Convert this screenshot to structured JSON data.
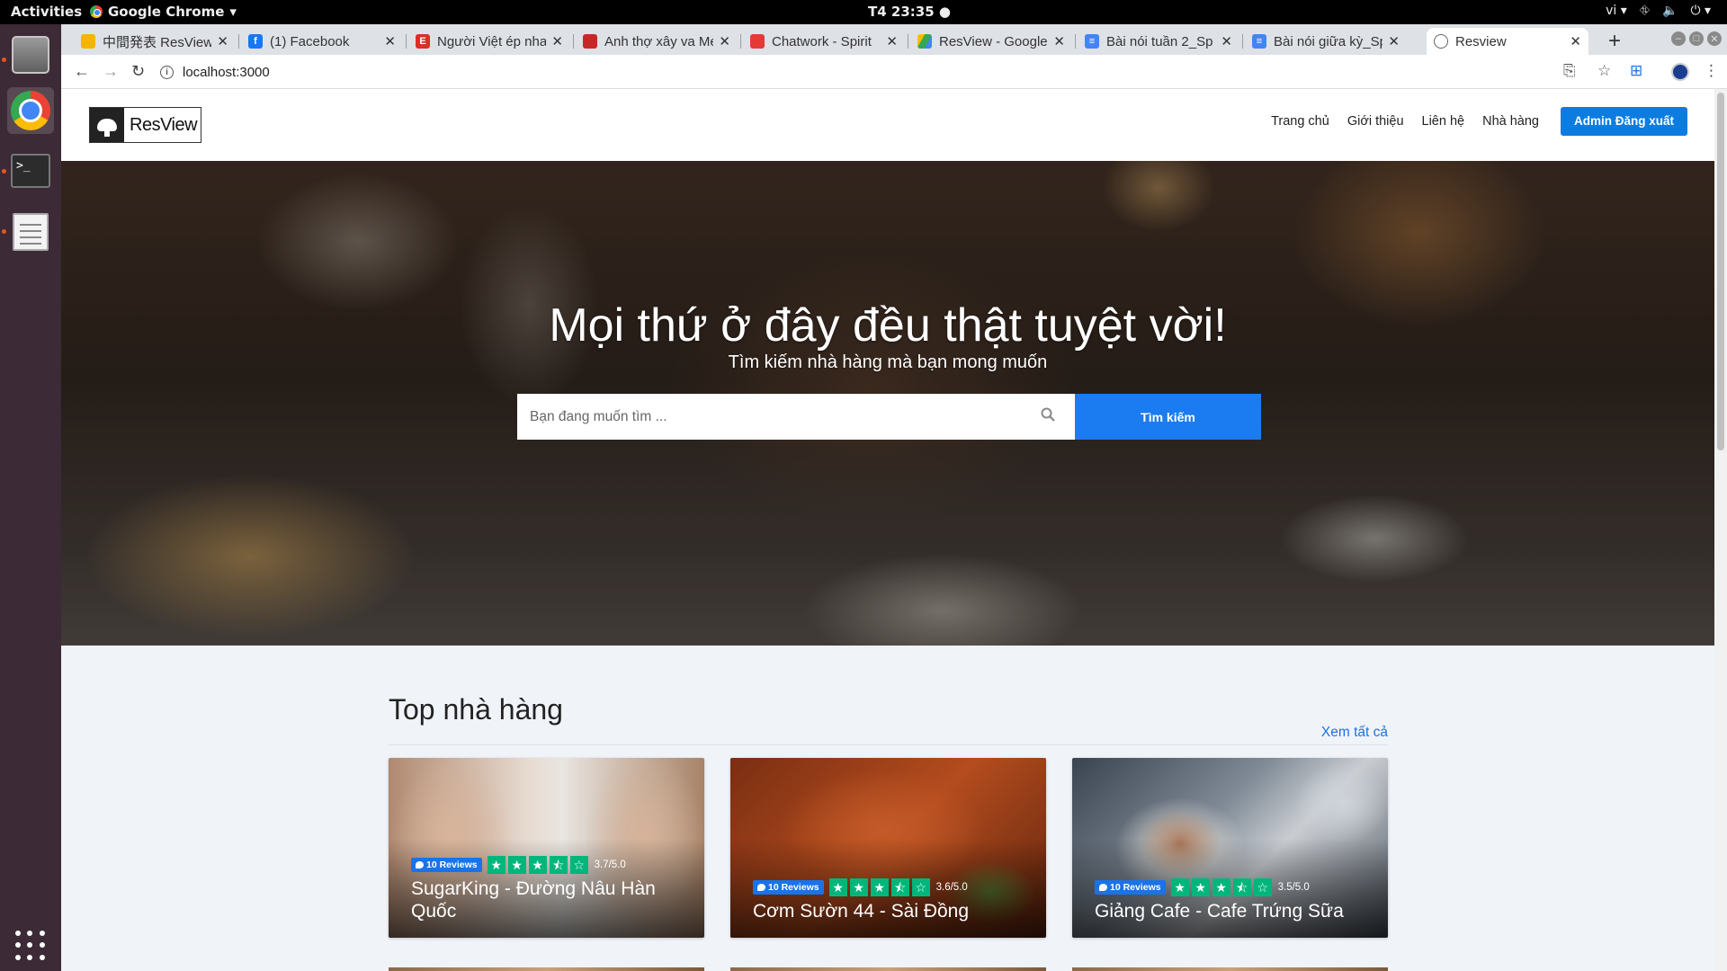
{
  "system": {
    "activities": "Activities",
    "app_menu": "Google Chrome",
    "clock": "T4 23:35",
    "lang": "vi"
  },
  "browser": {
    "tabs": [
      {
        "title": "中間発表 ResView",
        "fav_color": "#f4b400"
      },
      {
        "title": "(1) Facebook",
        "fav_color": "#1877f2",
        "fav_glyph": "f"
      },
      {
        "title": "Người Việt ép nha",
        "fav_color": "#d93025"
      },
      {
        "title": "Anh thợ xây va Me",
        "fav_color": "#c62828"
      },
      {
        "title": "Chatwork - Spirit",
        "fav_color": "#e53935"
      },
      {
        "title": "ResView - Google",
        "fav_color": "#34a853"
      },
      {
        "title": "Bài nói tuần 2_Sp",
        "fav_color": "#4285f4"
      },
      {
        "title": "Bài nói giữa kỳ_Sp",
        "fav_color": "#4285f4"
      },
      {
        "title": "Resview",
        "fav_color": "#5f6368",
        "active": true
      }
    ],
    "url": "localhost:3000"
  },
  "site": {
    "logo_text": "ResView",
    "nav": [
      "Trang chủ",
      "Giới thiệu",
      "Liên hệ",
      "Nhà hàng"
    ],
    "admin_button": "Admin Đăng xuất",
    "hero": {
      "title": "Mọi thứ ở đây đều thật tuyệt vời!",
      "subtitle": "Tìm kiếm nhà hàng mà bạn mong muốn",
      "search_placeholder": "Bạn đang muốn tìm ...",
      "search_button": "Tìm kiếm"
    },
    "top": {
      "heading": "Top nhà hàng",
      "see_all": "Xem tất cả",
      "restaurants": [
        {
          "name": "SugarKing - Đường Nâu Hàn Quốc",
          "reviews": "10 Reviews",
          "score": "3.7/5.0",
          "rating": 3.7
        },
        {
          "name": "Cơm Sườn 44 - Sài Đồng",
          "reviews": "10 Reviews",
          "score": "3.6/5.0",
          "rating": 3.6
        },
        {
          "name": "Giảng Cafe - Cafe Trứng Sữa",
          "reviews": "10 Reviews",
          "score": "3.5/5.0",
          "rating": 3.5
        }
      ]
    }
  }
}
